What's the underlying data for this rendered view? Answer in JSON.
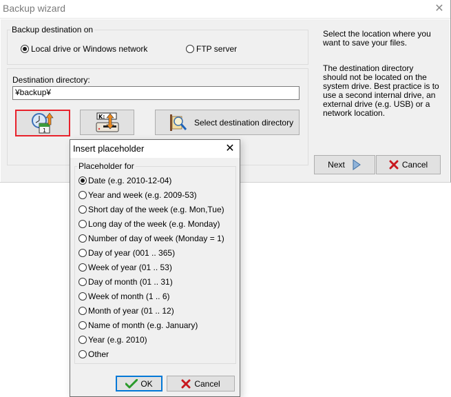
{
  "wizard": {
    "title": "Backup wizard",
    "destination_group": {
      "legend": "Backup destination on",
      "options": [
        {
          "label": "Local drive or Windows network",
          "checked": true
        },
        {
          "label": "FTP server",
          "checked": false
        }
      ]
    },
    "directory_group": {
      "label": "Destination directory:",
      "value": "¥backup¥"
    },
    "buttons": {
      "insert_placeholder_icon": "clock-calendar-icon",
      "drive_letter_icon": "drive-letter-icon",
      "select_directory_label": "Select destination directory"
    },
    "help": {
      "paragraph1": "Select the location where you want to save your files.",
      "paragraph2": "The destination directory should not be located on the system drive. Best practice is to use a second internal drive, an external drive (e.g. USB) or a network location."
    },
    "next_label": "Next",
    "cancel_label": "Cancel"
  },
  "dialog": {
    "title": "Insert placeholder",
    "legend": "Placeholder for",
    "options": [
      {
        "label": "Date (e.g. 2010-12-04)",
        "checked": true
      },
      {
        "label": "Year and week (e.g. 2009-53)",
        "checked": false
      },
      {
        "label": "Short day of the week (e.g. Mon,Tue)",
        "checked": false
      },
      {
        "label": "Long day of the week (e.g. Monday)",
        "checked": false
      },
      {
        "label": "Number of day of week (Monday = 1)",
        "checked": false
      },
      {
        "label": "Day of year (001 .. 365)",
        "checked": false
      },
      {
        "label": "Week of year (01 .. 53)",
        "checked": false
      },
      {
        "label": "Day of month (01 .. 31)",
        "checked": false
      },
      {
        "label": "Week of month (1 .. 6)",
        "checked": false
      },
      {
        "label": "Month of year (01 .. 12)",
        "checked": false
      },
      {
        "label": "Name of month (e.g. January)",
        "checked": false
      },
      {
        "label": "Year (e.g. 2010)",
        "checked": false
      },
      {
        "label": "Other",
        "checked": false
      }
    ],
    "ok_label": "OK",
    "cancel_label": "Cancel"
  },
  "colors": {
    "focus_red": "#e8202a",
    "focus_blue": "#0078d7",
    "cancel_x": "#c8171e",
    "ok_check": "#2a9a2a"
  }
}
